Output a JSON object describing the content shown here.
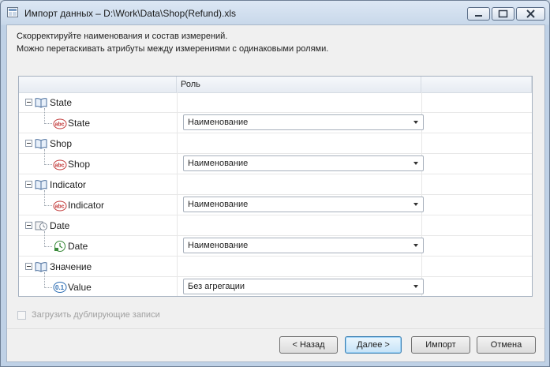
{
  "window": {
    "title": "Импорт данных – D:\\Work\\Data\\Shop(Refund).xls",
    "controls": [
      "minimize-icon",
      "maximize-icon",
      "close-icon"
    ]
  },
  "instructions": {
    "line1": "Скорректируйте наименования и состав измерений.",
    "line2": "Можно перетаскивать атрибуты между измерениями с одинаковыми ролями."
  },
  "grid": {
    "columns": [
      "",
      "Роль",
      ""
    ],
    "dimensions": [
      {
        "name": "State",
        "icon": "book-icon",
        "attribute": {
          "name": "State",
          "icon": "abc-icon",
          "role": "Наименование"
        }
      },
      {
        "name": "Shop",
        "icon": "book-icon",
        "attribute": {
          "name": "Shop",
          "icon": "abc-icon",
          "role": "Наименование"
        }
      },
      {
        "name": "Indicator",
        "icon": "book-icon",
        "attribute": {
          "name": "Indicator",
          "icon": "abc-icon",
          "role": "Наименование"
        }
      },
      {
        "name": "Date",
        "icon": "calendar-icon",
        "attribute": {
          "name": "Date",
          "icon": "date-icon",
          "role": "Наименование"
        }
      },
      {
        "name": "Значение",
        "icon": "book-icon",
        "attribute": {
          "name": "Value",
          "icon": "numeric-icon",
          "role": "Без агрегации"
        }
      }
    ]
  },
  "checkbox": {
    "label": "Загрузить дублирующие записи",
    "checked": false,
    "disabled": true
  },
  "buttons": {
    "back": "< Назад",
    "next": "Далее >",
    "import": "Импорт",
    "cancel": "Отмена"
  },
  "colors": {
    "accent": "#3c7fb1",
    "titlebar": "#c8d8ea"
  }
}
